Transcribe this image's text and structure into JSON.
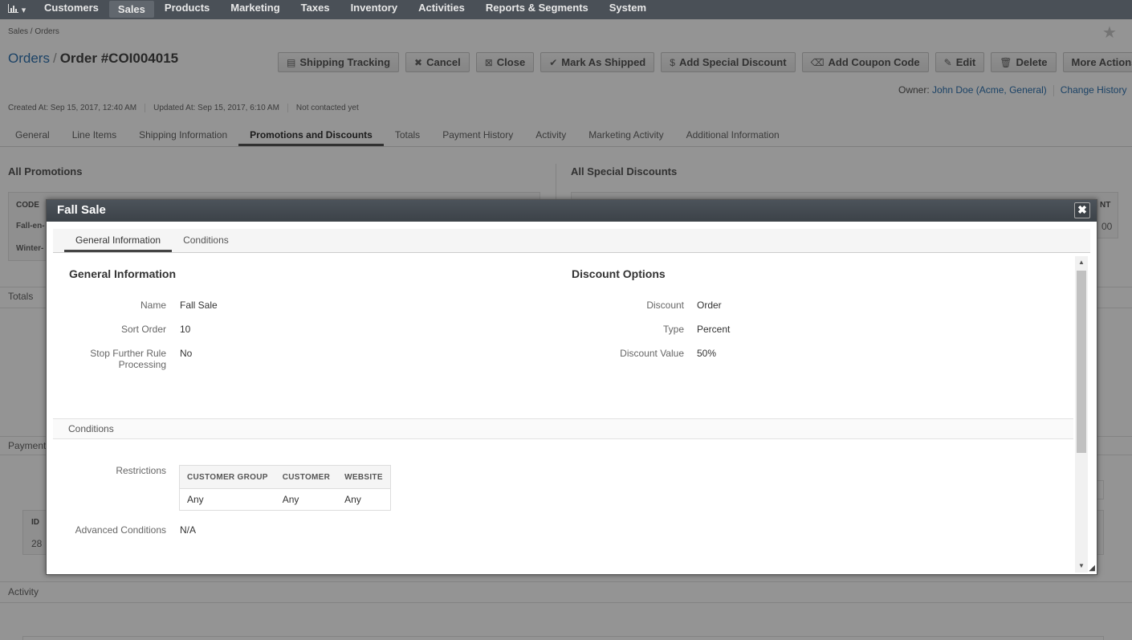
{
  "nav": {
    "logo_icon": "bar-chart-icon",
    "items": [
      "Customers",
      "Sales",
      "Products",
      "Marketing",
      "Taxes",
      "Inventory",
      "Activities",
      "Reports & Segments",
      "System"
    ],
    "active": "Sales"
  },
  "breadcrumb": "Sales / Orders",
  "page": {
    "title_link": "Orders",
    "separator": "/",
    "title": "Order #COI004015"
  },
  "actions": [
    {
      "label": "Shipping Tracking",
      "icon": "▤"
    },
    {
      "label": "Cancel",
      "icon": "✖"
    },
    {
      "label": "Close",
      "icon": "⊠"
    },
    {
      "label": "Mark As Shipped",
      "icon": "✔"
    },
    {
      "label": "Add Special Discount",
      "icon": "$"
    },
    {
      "label": "Add Coupon Code",
      "icon": "⌫"
    },
    {
      "label": "Edit",
      "icon": "✎"
    },
    {
      "label": "Delete",
      "icon": "🗑"
    },
    {
      "label": "More Actions",
      "icon": "▾"
    }
  ],
  "owner": {
    "label": "Owner:",
    "name": "John Doe (Acme, General)",
    "history": "Change History"
  },
  "meta": {
    "created": "Created At: Sep 15, 2017, 12:40 AM",
    "updated": "Updated At: Sep 15, 2017, 6:10 AM",
    "contact": "Not contacted yet"
  },
  "tabs": [
    "General",
    "Line Items",
    "Shipping Information",
    "Promotions and Discounts",
    "Totals",
    "Payment History",
    "Activity",
    "Marketing Activity",
    "Additional Information"
  ],
  "background": {
    "all_promotions": "All Promotions",
    "all_special_discounts": "All Special Discounts",
    "code_header": "CODE",
    "code_rows": [
      "Fall-en-",
      "Winter-"
    ],
    "amount_header_fragment": "NT",
    "amount_fragment": "00",
    "totals": "Totals",
    "payment": "Payment",
    "id_header": "ID",
    "id_value": "28",
    "activity": "Activity"
  },
  "dialog": {
    "title": "Fall Sale",
    "tabs": [
      "General Information",
      "Conditions"
    ],
    "general": {
      "heading": "General Information",
      "name_label": "Name",
      "name_value": "Fall Sale",
      "sort_label": "Sort Order",
      "sort_value": "10",
      "stop_label": "Stop Further Rule Processing",
      "stop_value": "No"
    },
    "discount": {
      "heading": "Discount Options",
      "discount_label": "Discount",
      "discount_value": "Order",
      "type_label": "Type",
      "type_value": "Percent",
      "value_label": "Discount Value",
      "value_value": "50%"
    },
    "conditions": {
      "bar": "Conditions",
      "restrictions_label": "Restrictions",
      "columns": [
        "CUSTOMER GROUP",
        "CUSTOMER",
        "WEBSITE"
      ],
      "row": [
        "Any",
        "Any",
        "Any"
      ],
      "advanced_label": "Advanced Conditions",
      "advanced_value": "N/A"
    }
  }
}
